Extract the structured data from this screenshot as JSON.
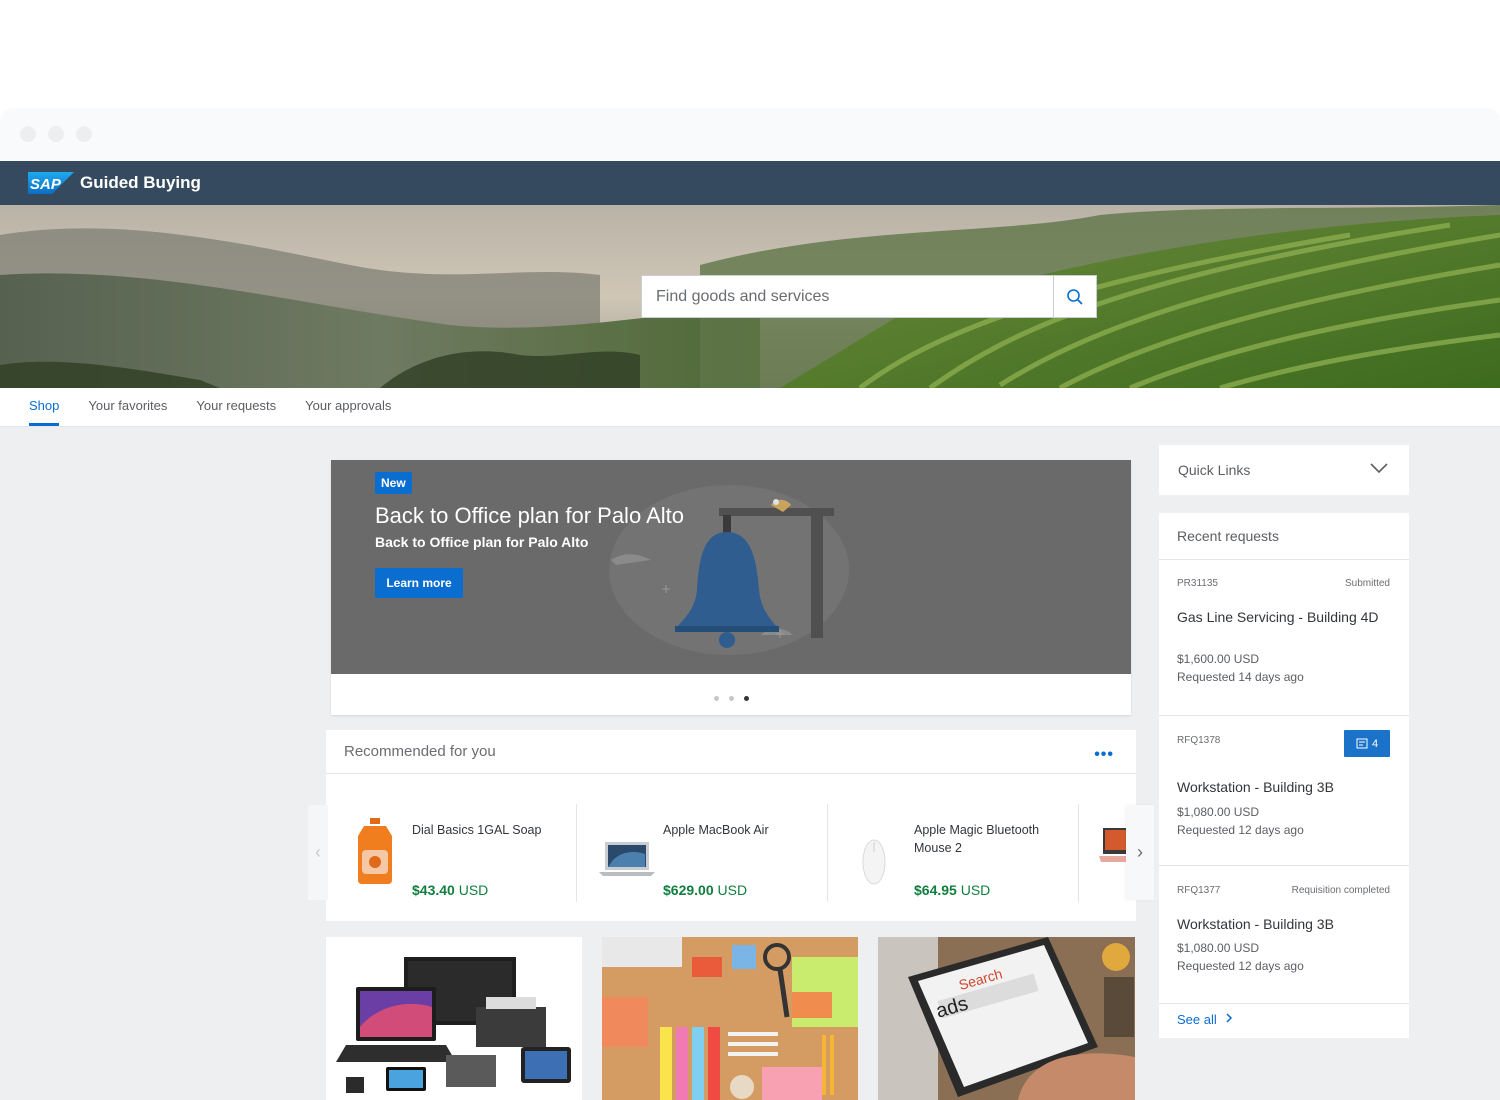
{
  "app": {
    "logo_text": "SAP",
    "title": "Guided Buying"
  },
  "search": {
    "placeholder": "Find goods and services"
  },
  "tabs": [
    {
      "label": "Shop",
      "active": true
    },
    {
      "label": "Your favorites",
      "active": false
    },
    {
      "label": "Your requests",
      "active": false
    },
    {
      "label": "Your approvals",
      "active": false
    }
  ],
  "promo": {
    "badge": "New",
    "title": "Back to Office plan for Palo Alto",
    "subtitle": "Back to Office plan for Palo Alto",
    "button": "Learn more",
    "pages": 3,
    "active_page": 3
  },
  "recommended": {
    "title": "Recommended for you",
    "more": "•••",
    "prev": "‹",
    "next": "›",
    "items": [
      {
        "name": "Dial Basics 1GAL Soap",
        "price": "$43.40",
        "currency": "USD",
        "icon": "soap-bottle-icon"
      },
      {
        "name": "Apple MacBook Air",
        "price": "$629.00",
        "currency": "USD",
        "icon": "laptop-icon"
      },
      {
        "name": "Apple Magic Bluetooth Mouse 2",
        "price": "$64.95",
        "currency": "USD",
        "icon": "mouse-icon"
      }
    ]
  },
  "tiles": [
    {
      "icon": "electronics-image"
    },
    {
      "icon": "office-supplies-image"
    },
    {
      "icon": "search-ads-laptop-image",
      "text_top": "Search",
      "text_main": "ads"
    }
  ],
  "quick_links": {
    "label": "Quick Links"
  },
  "recent": {
    "title": "Recent requests",
    "items": [
      {
        "id": "PR31135",
        "status": "Submitted",
        "title": "Gas Line Servicing - Building 4D",
        "amount": "$1,600.00 USD",
        "date": "Requested 14 days ago"
      },
      {
        "id": "RFQ1378",
        "badge": "4",
        "title": "Workstation - Building 3B",
        "amount": "$1,080.00 USD",
        "date": "Requested 12 days ago"
      },
      {
        "id": "RFQ1377",
        "status": "Requisition completed",
        "title": "Workstation - Building 3B",
        "amount": "$1,080.00 USD",
        "date": "Requested 12 days ago"
      }
    ],
    "see_all": "See all"
  },
  "colors": {
    "shellbar": "#354a5f",
    "accent": "#0a6ed1",
    "price": "#107e3e",
    "background": "#edeff0"
  }
}
